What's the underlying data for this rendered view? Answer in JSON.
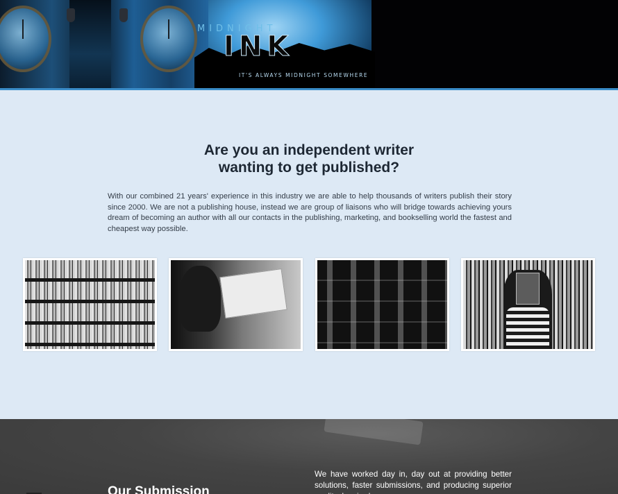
{
  "header": {
    "logo_top": "MIDNIGHT",
    "logo_main": "INK",
    "tagline": "IT'S ALWAYS MIDNIGHT SOMEWHERE"
  },
  "intro": {
    "headline_line1": "Are you an independent writer",
    "headline_line2": "wanting to get published?",
    "body": "With our combined 21 years' experience in this industry we are able to help thousands of writers publish their story since 2000. We are not a publishing house, instead we are group of liaisons who will bridge towards achieving yours dream of becoming an author with all our contacts in the publishing, marketing, and bookselling world the fastest and cheapest way possible."
  },
  "gallery": {
    "photos": [
      {
        "subject": "bookshelves"
      },
      {
        "subject": "person reading picture book"
      },
      {
        "subject": "bookstore display"
      },
      {
        "subject": "girl holding book in front of shelves"
      }
    ]
  },
  "submission": {
    "heading": "Our Submission",
    "text": "We have worked day in, day out at providing better solutions, faster submissions, and producing superior quality. Inspired"
  },
  "colors": {
    "page_background": "#dde9f5",
    "banner_accent": "#3a8cc8",
    "dark_section": "#444444"
  }
}
